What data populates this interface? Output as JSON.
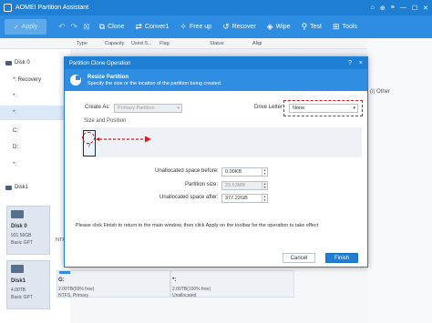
{
  "app": {
    "title": "AOMEI Partition Assistant",
    "window_controls": [
      "⌂",
      "⊕",
      "≡",
      "—",
      "☐",
      "✕"
    ]
  },
  "toolbar": {
    "apply": "Apply",
    "items": [
      {
        "label": "Clone",
        "icon": "clone-icon"
      },
      {
        "label": "Conver1",
        "icon": "convert-icon"
      },
      {
        "label": "Free up",
        "icon": "free-up-icon"
      },
      {
        "label": "Recover",
        "icon": "recover-icon"
      },
      {
        "label": "Wipe",
        "icon": "wipe-icon"
      },
      {
        "label": "Test",
        "icon": "test-icon"
      },
      {
        "label": "Tools",
        "icon": "tools-icon"
      }
    ]
  },
  "columns": [
    "Type",
    "Capacity",
    "Used S...",
    "Flag",
    "Status",
    "Aligi"
  ],
  "left_tree": [
    {
      "label": "Disk 0",
      "kind": "disk"
    },
    {
      "label": "*: Recovery",
      "kind": "part"
    },
    {
      "label": "*:",
      "kind": "part"
    },
    {
      "label": "*:",
      "kind": "part",
      "selected": true
    },
    {
      "label": "C:",
      "kind": "part"
    },
    {
      "label": "D:",
      "kind": "part"
    },
    {
      "label": "*:",
      "kind": "part"
    },
    {
      "label": "Disk1",
      "kind": "disk"
    }
  ],
  "disk_cards": [
    {
      "name": "Disk 0",
      "size": "931.56GB",
      "type": "Basic GPT",
      "right": "NTFS"
    },
    {
      "name": "Disk1",
      "size": "4.00TB",
      "type": "Basic GPT",
      "parts": [
        {
          "drive": "G:",
          "detail": "2.00TB(99% free)",
          "fs": "NTFS, Primary"
        },
        {
          "drive": "*:",
          "detail": "2.00TB(100% free)",
          "fs": "Unallocated"
        }
      ]
    }
  ],
  "right_other": "(i) Other",
  "dialog": {
    "title": "Partition Clone Operation",
    "help": "?",
    "close": "×",
    "header_title": "Resize Partition",
    "header_sub": "Specify the size or the location of the partition being created.",
    "create_as_label": "Create As:",
    "create_as_value": "Primary Partition",
    "drive_letter_label": "Drive Letter:",
    "drive_letter_value": "None",
    "size_position_label": "Size and Position",
    "part_mark": "?",
    "unalloc_before_label": "Unallocated space before:",
    "unalloc_before_value": "0.00KB",
    "partition_size_label": "Partition size:",
    "partition_size_value": "23.53MB",
    "unalloc_after_label": "Unallocated space after:",
    "unalloc_after_value": "377.22GB",
    "note": "Please click Finish to return to the main window, then click Apply on the toolbar for the operation to take effect",
    "cancel": "Cancel",
    "finish": "Finish"
  },
  "colors": {
    "accent": "#1f7fd4",
    "annotation": "#e01818"
  }
}
